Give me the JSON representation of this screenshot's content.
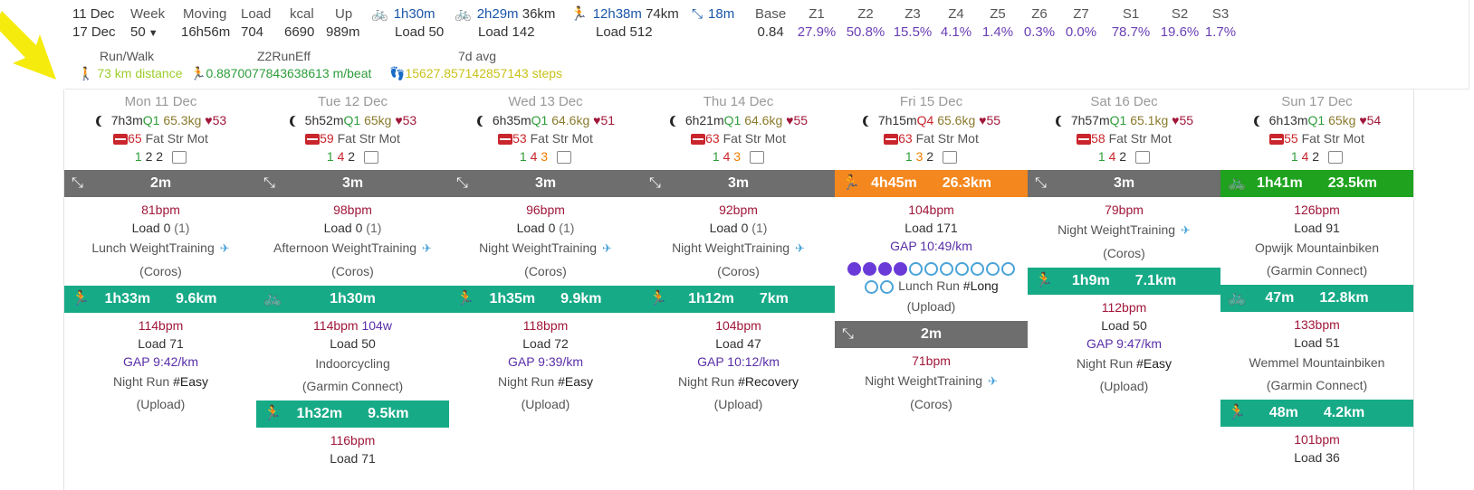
{
  "summary": {
    "date_from": "11 Dec",
    "date_to": "17 Dec",
    "week_label": "Week",
    "week_value": "50",
    "moving_label": "Moving",
    "moving_value": "16h56m",
    "load_label": "Load",
    "load_value": "704",
    "kcal_label": "kcal",
    "kcal_value": "6690",
    "up_label": "Up",
    "up_value": "989m",
    "bike1_time": "1h30m",
    "bike1_load": "Load 50",
    "bike2_time": "2h29m",
    "bike2_dist": "36km",
    "bike2_load": "Load 142",
    "run_time": "12h38m",
    "run_dist": "74km",
    "run_load": "Load 512",
    "other_time": "18m",
    "zones": [
      {
        "label": "Base",
        "value": "0.84"
      },
      {
        "label": "Z1",
        "value": "27.9%"
      },
      {
        "label": "Z2",
        "value": "50.8%"
      },
      {
        "label": "Z3",
        "value": "15.5%"
      },
      {
        "label": "Z4",
        "value": "4.1%"
      },
      {
        "label": "Z5",
        "value": "1.4%"
      },
      {
        "label": "Z6",
        "value": "0.3%"
      },
      {
        "label": "Z7",
        "value": "0.0%"
      },
      {
        "label": "S1",
        "value": "78.7%"
      },
      {
        "label": "S2",
        "value": "19.6%"
      },
      {
        "label": "S3",
        "value": "1.7%"
      }
    ],
    "row2": {
      "runwalk_label": "Run/Walk",
      "runwalk_value": "73 km distance",
      "z2_label": "Z2RunEff",
      "z2_value": "0.8870077843638613 m/beat",
      "avg_label": "7d avg",
      "avg_value": "15627.857142857143 steps"
    }
  },
  "days": [
    {
      "header": "Mon 11 Dec",
      "sleep": "7h3m",
      "q": "Q1",
      "q_color": "#2e9d3a",
      "weight": "65.3kg",
      "hr": "53",
      "rhr": "65",
      "fsm_label": "Fat Str Mot",
      "fat": "1",
      "str": "2",
      "mot": "2",
      "activities": [
        {
          "kind": "other",
          "color": "gray",
          "time": "2m",
          "dist": "",
          "bpm": "81bpm",
          "load": "Load 0",
          "load_extra": "(1)",
          "gap": "",
          "name": "Lunch WeightTraining",
          "tag": "",
          "pin": true,
          "src": "(Coros)"
        },
        {
          "kind": "run",
          "color": "teal",
          "time": "1h33m",
          "dist": "9.6km",
          "bpm": "114bpm",
          "load": "Load 71",
          "load_extra": "",
          "gap": "GAP 9:42/km",
          "name": "Night Run",
          "tag": "#Easy",
          "pin": false,
          "src": "(Upload)"
        }
      ]
    },
    {
      "header": "Tue 12 Dec",
      "sleep": "5h52m",
      "q": "Q1",
      "q_color": "#2e9d3a",
      "weight": "65kg",
      "hr": "53",
      "rhr": "59",
      "fsm_label": "Fat Str Mot",
      "fat": "1",
      "str": "4",
      "mot": "2",
      "activities": [
        {
          "kind": "other",
          "color": "gray",
          "time": "3m",
          "dist": "",
          "bpm": "98bpm",
          "load": "Load 0",
          "load_extra": "(1)",
          "gap": "",
          "name": "Afternoon WeightTraining",
          "tag": "",
          "pin": true,
          "src": "(Coros)"
        },
        {
          "kind": "bike",
          "color": "teal",
          "time": "1h30m",
          "dist": "",
          "bpm": "114bpm",
          "watts": "104w",
          "load": "Load 50",
          "load_extra": "",
          "gap": "",
          "name": "Indoorcycling",
          "tag": "",
          "pin": false,
          "src": "(Garmin Connect)"
        },
        {
          "kind": "run",
          "color": "teal",
          "time": "1h32m",
          "dist": "9.5km",
          "bpm": "116bpm",
          "load": "Load 71",
          "load_extra": "",
          "gap": "",
          "name": "",
          "tag": "",
          "pin": false,
          "src": ""
        }
      ]
    },
    {
      "header": "Wed 13 Dec",
      "sleep": "6h35m",
      "q": "Q1",
      "q_color": "#2e9d3a",
      "weight": "64.6kg",
      "hr": "51",
      "rhr": "53",
      "fsm_label": "Fat Str Mot",
      "fat": "1",
      "str": "4",
      "mot": "3",
      "activities": [
        {
          "kind": "other",
          "color": "gray",
          "time": "3m",
          "dist": "",
          "bpm": "96bpm",
          "load": "Load 0",
          "load_extra": "(1)",
          "gap": "",
          "name": "Night WeightTraining",
          "tag": "",
          "pin": true,
          "src": "(Coros)"
        },
        {
          "kind": "run",
          "color": "teal",
          "time": "1h35m",
          "dist": "9.9km",
          "bpm": "118bpm",
          "load": "Load 72",
          "load_extra": "",
          "gap": "GAP 9:39/km",
          "name": "Night Run",
          "tag": "#Easy",
          "pin": false,
          "src": "(Upload)"
        }
      ]
    },
    {
      "header": "Thu 14 Dec",
      "sleep": "6h21m",
      "q": "Q1",
      "q_color": "#2e9d3a",
      "weight": "64.6kg",
      "hr": "55",
      "rhr": "63",
      "fsm_label": "Fat Str Mot",
      "fat": "1",
      "str": "4",
      "mot": "3",
      "activities": [
        {
          "kind": "other",
          "color": "gray",
          "time": "3m",
          "dist": "",
          "bpm": "92bpm",
          "load": "Load 0",
          "load_extra": "(1)",
          "gap": "",
          "name": "Night WeightTraining",
          "tag": "",
          "pin": true,
          "src": "(Coros)"
        },
        {
          "kind": "run",
          "color": "teal",
          "time": "1h12m",
          "dist": "7km",
          "bpm": "104bpm",
          "load": "Load 47",
          "load_extra": "",
          "gap": "GAP 10:12/km",
          "name": "Night Run",
          "tag": "#Recovery",
          "pin": false,
          "src": "(Upload)"
        }
      ]
    },
    {
      "header": "Fri 15 Dec",
      "sleep": "7h15m",
      "q": "Q4",
      "q_color": "#c9252c",
      "weight": "65.6kg",
      "hr": "55",
      "rhr": "63",
      "fsm_label": "Fat Str Mot",
      "fat": "1",
      "str": "3",
      "mot": "2",
      "activities": [
        {
          "kind": "run",
          "color": "orange",
          "time": "4h45m",
          "dist": "26.3km",
          "bpm": "104bpm",
          "load": "Load 171",
          "load_extra": "",
          "gap": "GAP 10:49/km",
          "name": "Lunch Run",
          "tag": "#Long",
          "pin": false,
          "src": "(Upload)",
          "badges": true
        },
        {
          "kind": "other",
          "color": "gray",
          "time": "2m",
          "dist": "",
          "bpm": "71bpm",
          "load": "",
          "load_extra": "",
          "gap": "",
          "name": "Night WeightTraining",
          "tag": "",
          "pin": true,
          "src": "(Coros)"
        }
      ]
    },
    {
      "header": "Sat 16 Dec",
      "sleep": "7h57m",
      "q": "Q1",
      "q_color": "#2e9d3a",
      "weight": "65.1kg",
      "hr": "55",
      "rhr": "58",
      "fsm_label": "Fat Str Mot",
      "fat": "1",
      "str": "4",
      "mot": "2",
      "activities": [
        {
          "kind": "other",
          "color": "gray",
          "time": "3m",
          "dist": "",
          "bpm": "79bpm",
          "load": "",
          "load_extra": "",
          "gap": "",
          "name": "Night WeightTraining",
          "tag": "",
          "pin": true,
          "src": "(Coros)"
        },
        {
          "kind": "run",
          "color": "teal",
          "time": "1h9m",
          "dist": "7.1km",
          "bpm": "112bpm",
          "load": "Load 50",
          "load_extra": "",
          "gap": "GAP 9:47/km",
          "name": "Night Run",
          "tag": "#Easy",
          "pin": false,
          "src": "(Upload)"
        }
      ]
    },
    {
      "header": "Sun 17 Dec",
      "sleep": "6h13m",
      "q": "Q1",
      "q_color": "#2e9d3a",
      "weight": "65kg",
      "hr": "54",
      "rhr": "55",
      "fsm_label": "Fat Str Mot",
      "fat": "1",
      "str": "4",
      "mot": "2",
      "activities": [
        {
          "kind": "bike",
          "color": "green",
          "time": "1h41m",
          "dist": "23.5km",
          "bpm": "126bpm",
          "load": "Load 91",
          "load_extra": "",
          "gap": "",
          "name": "Opwijk Mountainbiken",
          "tag": "",
          "pin": false,
          "src": "(Garmin Connect)"
        },
        {
          "kind": "bike",
          "color": "teal",
          "time": "47m",
          "dist": "12.8km",
          "bpm": "133bpm",
          "load": "Load 51",
          "load_extra": "",
          "gap": "",
          "name": "Wemmel Mountainbiken",
          "tag": "",
          "pin": false,
          "src": "(Garmin Connect)"
        },
        {
          "kind": "run",
          "color": "teal",
          "time": "48m",
          "dist": "4.2km",
          "bpm": "101bpm",
          "load": "Load 36",
          "load_extra": "",
          "gap": "",
          "name": "",
          "tag": "",
          "pin": false,
          "src": ""
        }
      ]
    }
  ]
}
